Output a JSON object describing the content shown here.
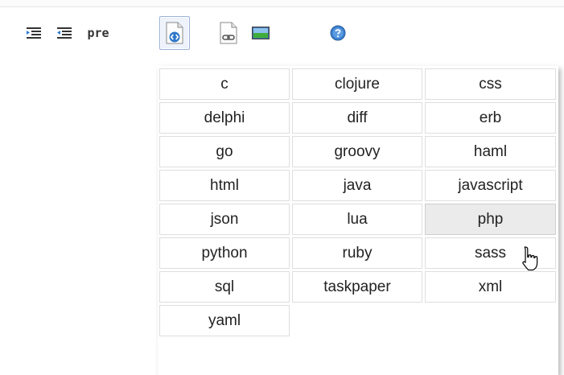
{
  "toolbar": {
    "buttons": [
      {
        "name": "indent",
        "icon": "indent-icon"
      },
      {
        "name": "outdent",
        "icon": "outdent-icon"
      },
      {
        "name": "pre",
        "label": "pre"
      },
      {
        "name": "code",
        "icon": "code-file-icon",
        "active": true
      },
      {
        "name": "link",
        "icon": "link-file-icon"
      },
      {
        "name": "image",
        "icon": "image-icon"
      },
      {
        "name": "help",
        "icon": "help-icon"
      }
    ]
  },
  "languages": {
    "items": [
      "c",
      "clojure",
      "css",
      "delphi",
      "diff",
      "erb",
      "go",
      "groovy",
      "haml",
      "html",
      "java",
      "javascript",
      "json",
      "lua",
      "php",
      "python",
      "ruby",
      "sass",
      "sql",
      "taskpaper",
      "xml",
      "yaml"
    ],
    "hovered": "php"
  },
  "colors": {
    "active_border": "#9cb2d8",
    "hover_bg": "#ebebeb",
    "cell_border": "#dedede"
  }
}
